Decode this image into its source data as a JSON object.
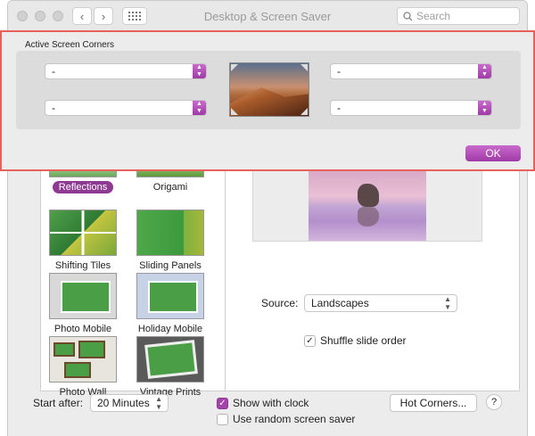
{
  "window": {
    "title": "Desktop & Screen Saver"
  },
  "search": {
    "placeholder": "Search"
  },
  "sheet": {
    "section_label": "Active Screen Corners",
    "corners": {
      "top_left": "-",
      "top_right": "-",
      "bottom_left": "-",
      "bottom_right": "-"
    },
    "ok_label": "OK"
  },
  "screen_savers": [
    {
      "label": "Reflections",
      "selected": true
    },
    {
      "label": "Origami",
      "selected": false
    },
    {
      "label": "Shifting Tiles",
      "selected": false
    },
    {
      "label": "Sliding Panels",
      "selected": false
    },
    {
      "label": "Photo Mobile",
      "selected": false
    },
    {
      "label": "Holiday Mobile",
      "selected": false
    },
    {
      "label": "Photo Wall",
      "selected": false
    },
    {
      "label": "Vintage Prints",
      "selected": false
    }
  ],
  "options": {
    "source_label": "Source:",
    "source_value": "Landscapes",
    "shuffle_label": "Shuffle slide order",
    "shuffle_checked": true
  },
  "footer": {
    "start_after_label": "Start after:",
    "start_after_value": "20 Minutes",
    "show_clock_label": "Show with clock",
    "show_clock_checked": true,
    "random_label": "Use random screen saver",
    "random_checked": false,
    "hot_corners_label": "Hot Corners...",
    "help_label": "?"
  },
  "colors": {
    "accent": "#a344a9",
    "highlight_border": "#e8605a"
  }
}
